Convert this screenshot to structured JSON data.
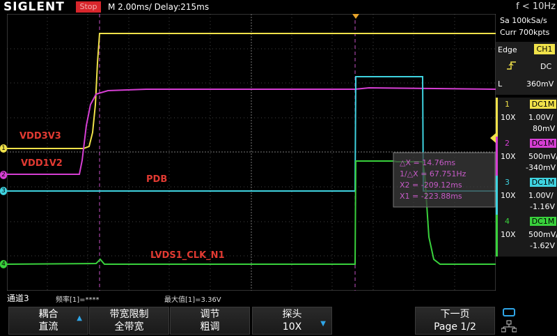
{
  "topbar": {
    "brand": "SIGLENT",
    "run_state": "Stop",
    "timebase": "M 2.00ms/ Delay:215ms",
    "frequency": "f < 10Hz"
  },
  "acquisition": {
    "sample_rate": "Sa 100kSa/s",
    "memory": "Curr 700kpts"
  },
  "trigger": {
    "mode": "Edge",
    "source": "CH1",
    "slope_icon": "rising-edge-icon",
    "coupling": "DC",
    "level_label": "L",
    "level": "360mV"
  },
  "channels": [
    {
      "num": "1",
      "coupling": "DC1M",
      "probe": "10X",
      "scale": "1.00V/",
      "offset": "80mV",
      "color": "#f0e24a"
    },
    {
      "num": "2",
      "coupling": "DC1M",
      "probe": "10X",
      "scale": "500mV/",
      "offset": "-340mV",
      "color": "#d63fd4"
    },
    {
      "num": "3",
      "coupling": "DC1M",
      "probe": "10X",
      "scale": "1.00V/",
      "offset": "-1.16V",
      "color": "#3fd3e0"
    },
    {
      "num": "4",
      "coupling": "DC1M",
      "probe": "10X",
      "scale": "500mV/",
      "offset": "-1.62V",
      "color": "#39d13c"
    }
  ],
  "cursor_readout": {
    "delta": "△X = 14.76ms",
    "inv_delta": "1/△X = 67.751Hz",
    "x2": "X2 = -209.12ms",
    "x1": "X1 = -223.88ms"
  },
  "trace_labels": {
    "ch1": "VDD3V3",
    "ch2": "VDD1V2",
    "ch3": "PDB",
    "ch4": "LVDS1_CLK_N1"
  },
  "status": {
    "channel_label": "通道3",
    "freq_meas": "频率[1]=****",
    "max_meas": "最大值[1]=3.36V"
  },
  "softkeys": [
    {
      "line1": "耦合",
      "line2": "直流"
    },
    {
      "line1": "带宽限制",
      "line2": "全带宽"
    },
    {
      "line1": "调节",
      "line2": "粗调"
    },
    {
      "line1": "探头",
      "line2": "10X"
    },
    {
      "line1": "下一页",
      "line2": "Page 1/2"
    }
  ],
  "colors": {
    "ch1": "#f0e24a",
    "ch2": "#d63fd4",
    "ch3": "#3fd3e0",
    "ch4": "#39d13c",
    "stop": "#d8262c",
    "accent_blue": "#2fa6e8",
    "label_red": "#e23a32"
  }
}
